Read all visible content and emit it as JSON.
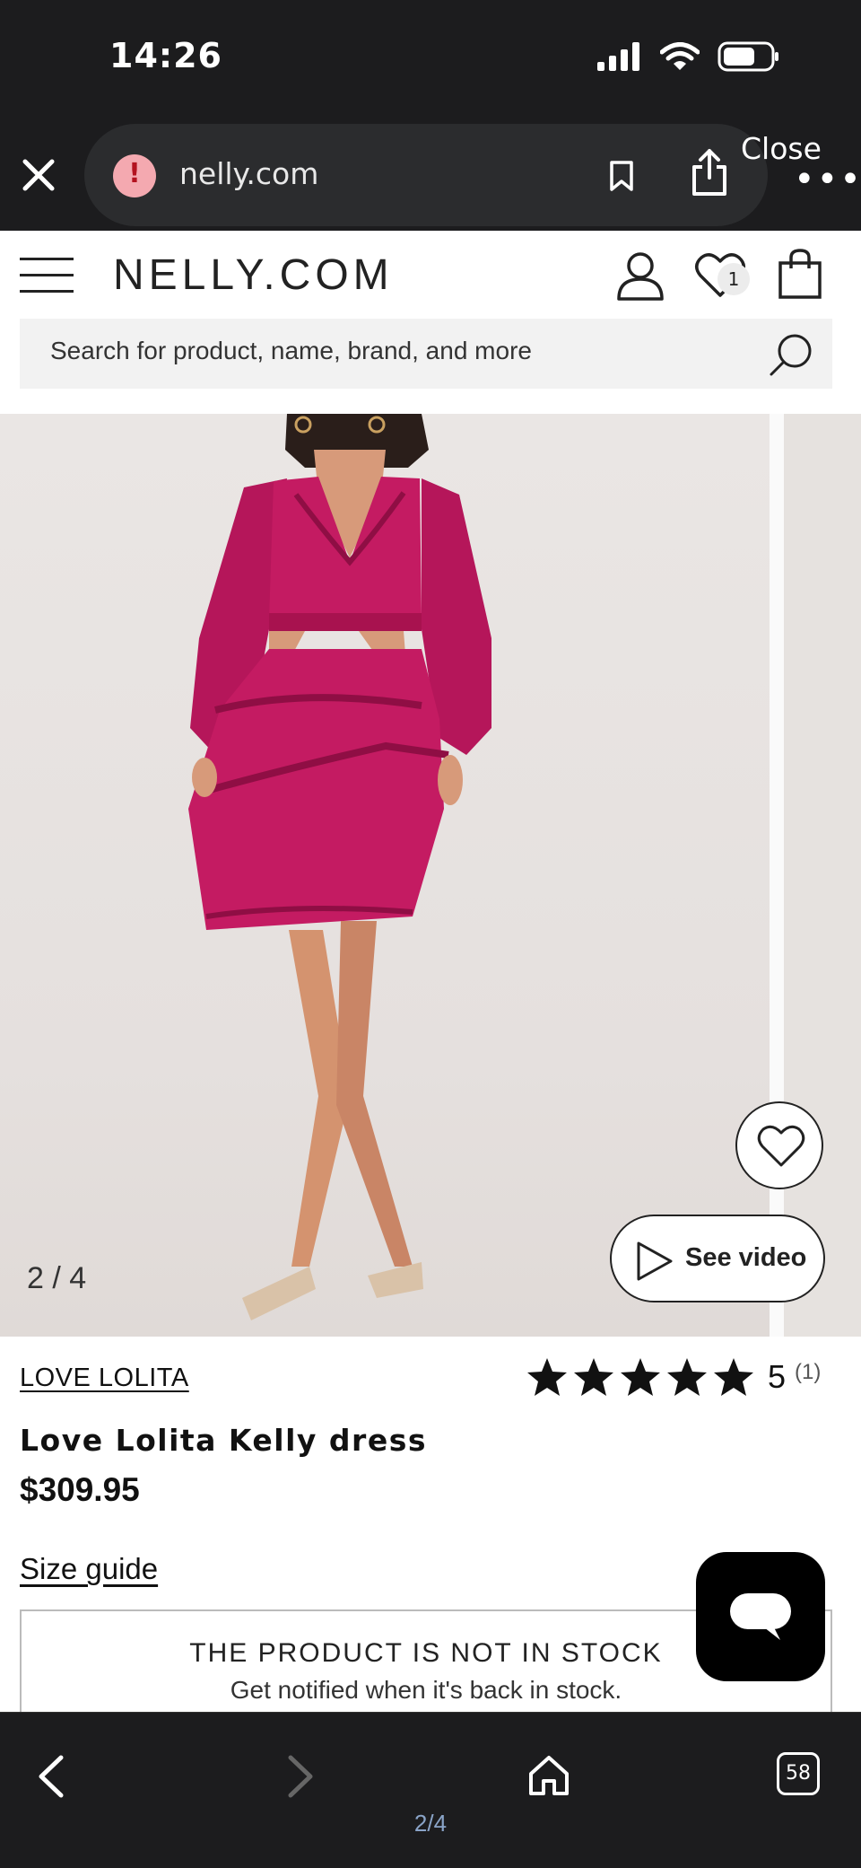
{
  "status_bar": {
    "time": "14:26",
    "icons": [
      "signal-icon",
      "wifi-icon",
      "battery-icon"
    ]
  },
  "browser": {
    "url": "nelly.com",
    "close_label": "Close",
    "more_label": "•••",
    "security_icon": "alert-icon"
  },
  "site": {
    "logo": "NELLY.COM",
    "wishlist_count": "1",
    "search_placeholder": "Search for product, name, brand, and more"
  },
  "gallery": {
    "slide_counter": "2 / 4",
    "see_video_label": "See video"
  },
  "product": {
    "brand": "LOVE LOLITA",
    "name": "Love Lolita Kelly dress",
    "price": "$309.95",
    "rating_score": "5",
    "rating_count": "(1)",
    "rating_stars": 5,
    "size_guide": "Size guide",
    "stock_title": "THE PRODUCT IS NOT IN STOCK",
    "stock_sub": "Get notified when it's back in stock."
  },
  "toolbar": {
    "tab_count": "58",
    "page_indicator": "2/4"
  },
  "colors": {
    "chrome_bg": "#1c1c1e",
    "dress": "#c0175d",
    "text": "#111111"
  }
}
